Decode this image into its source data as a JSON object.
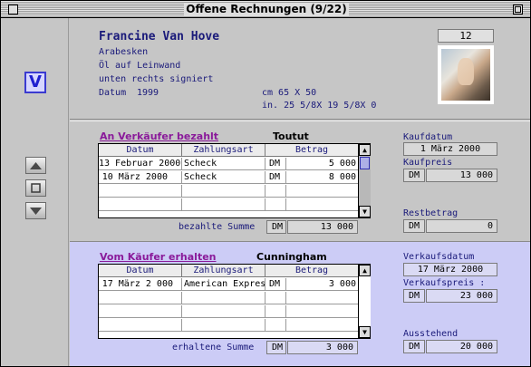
{
  "window": {
    "title": "Offene Rechnungen (9/22)"
  },
  "nav": {
    "v_label": "V"
  },
  "record": {
    "artist": "Francine Van Hove",
    "title": "Arabesken",
    "medium": "Öl auf Leinwand",
    "signature": "unten rechts signiert",
    "date_label": "Datum",
    "date_value": "1999",
    "size_cm": "cm  65 X 50",
    "size_in": "in.   25 5/8X   19 5/8X    0",
    "number": "12"
  },
  "purchase": {
    "section_title": "An Verkäufer bezahlt",
    "party": "Toutut",
    "columns": [
      "Datum",
      "Zahlungsart",
      "Betrag"
    ],
    "rows": [
      {
        "date": "13 Februar 2000",
        "method": "Scheck",
        "currency": "DM",
        "amount": "5 000"
      },
      {
        "date": "10 März 2000",
        "method": "Scheck",
        "currency": "DM",
        "amount": "8 000"
      }
    ],
    "sum_label": "bezahlte Summe",
    "sum_currency": "DM",
    "sum_value": "13 000",
    "date_label": "Kaufdatum",
    "date_value": "1 März 2000",
    "price_label": "Kaufpreis",
    "price_currency": "DM",
    "price_value": "13 000",
    "rest_label": "Restbetrag",
    "rest_currency": "DM",
    "rest_value": "0"
  },
  "sale": {
    "section_title": "Vom Käufer erhalten",
    "party": "Cunningham",
    "columns": [
      "Datum",
      "Zahlungsart",
      "Betrag"
    ],
    "rows": [
      {
        "date": "17 März 2 000",
        "method": "American Express",
        "currency": "DM",
        "amount": "3 000"
      }
    ],
    "sum_label": "erhaltene Summe",
    "sum_currency": "DM",
    "sum_value": "3 000",
    "date_label": "Verkaufsdatum",
    "date_value": "17 März 2000",
    "price_label": "Verkaufspreis :",
    "price_currency": "DM",
    "price_value": "23 000",
    "due_label": "Ausstehend",
    "due_currency": "DM",
    "due_value": "20 000"
  },
  "colors": {
    "titlebar": "#9c9c9c",
    "panel": "#c6c6c6",
    "sale_panel": "#ccccf6",
    "accent_purple": "#8a1a9a",
    "nav_blue": "#1f1fd0"
  }
}
